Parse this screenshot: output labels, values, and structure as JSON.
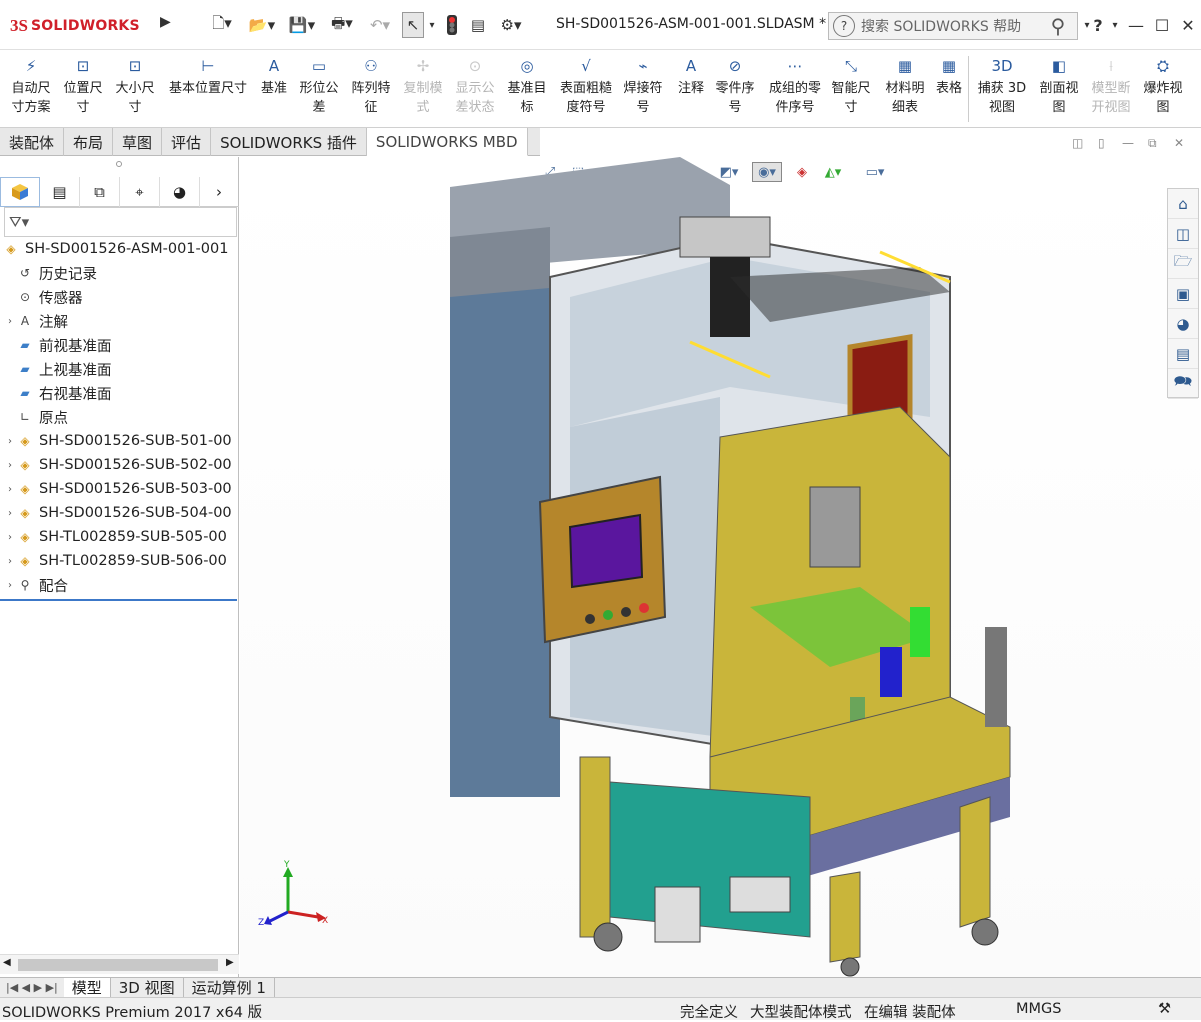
{
  "app": {
    "logo_ds": "3S",
    "logo_name": "SOLIDWORKS",
    "document_title": "SH-SD001526-ASM-001-001.SLDASM *",
    "search_placeholder": "搜索 SOLIDWORKS 帮助",
    "help_label": "?"
  },
  "ribbon": [
    {
      "label1": "自动尺",
      "label2": "寸方案",
      "icon": "auto-dimension-icon",
      "enabled": true
    },
    {
      "label1": "位置尺",
      "label2": "寸",
      "icon": "location-dimension-icon",
      "enabled": true
    },
    {
      "label1": "大小尺",
      "label2": "寸",
      "icon": "size-dimension-icon",
      "enabled": true
    },
    {
      "label1": "基本位置尺寸",
      "label2": "",
      "icon": "basic-location-dimension-icon",
      "enabled": true
    },
    {
      "label1": "基准",
      "label2": "",
      "icon": "datum-icon",
      "enabled": true
    },
    {
      "label1": "形位公",
      "label2": "差",
      "icon": "geometric-tolerance-icon",
      "enabled": true
    },
    {
      "label1": "阵列特",
      "label2": "征",
      "icon": "pattern-feature-icon",
      "enabled": true
    },
    {
      "label1": "复制模",
      "label2": "式",
      "icon": "copy-scheme-icon",
      "enabled": false
    },
    {
      "label1": "显示公",
      "label2": "差状态",
      "icon": "show-tolerance-status-icon",
      "enabled": false
    },
    {
      "label1": "基准目",
      "label2": "标",
      "icon": "datum-target-icon",
      "enabled": true
    },
    {
      "label1": "表面粗糙",
      "label2": "度符号",
      "icon": "surface-finish-icon",
      "enabled": true
    },
    {
      "label1": "焊接符",
      "label2": "号",
      "icon": "weld-symbol-icon",
      "enabled": true
    },
    {
      "label1": "注释",
      "label2": "",
      "icon": "note-icon",
      "enabled": true
    },
    {
      "label1": "零件序",
      "label2": "号",
      "icon": "balloon-icon",
      "enabled": true
    },
    {
      "label1": "成组的零",
      "label2": "件序号",
      "icon": "stacked-balloon-icon",
      "enabled": true
    },
    {
      "label1": "智能尺",
      "label2": "寸",
      "icon": "smart-dimension-icon",
      "enabled": true
    },
    {
      "label1": "材料明",
      "label2": "细表",
      "icon": "bom-icon",
      "enabled": true
    },
    {
      "label1": "表格",
      "label2": "",
      "icon": "table-icon",
      "enabled": true
    },
    {
      "label1": "捕获 3D",
      "label2": "视图",
      "icon": "capture-3d-view-icon",
      "enabled": true
    },
    {
      "label1": "剖面视",
      "label2": "图",
      "icon": "section-view-icon",
      "enabled": true
    },
    {
      "label1": "模型断",
      "label2": "开视图",
      "icon": "model-break-view-icon",
      "enabled": false
    },
    {
      "label1": "爆炸视",
      "label2": "图",
      "icon": "exploded-view-icon",
      "enabled": true
    }
  ],
  "tabs": [
    "装配体",
    "布局",
    "草图",
    "评估",
    "SOLIDWORKS 插件",
    "SOLIDWORKS MBD"
  ],
  "active_tab": "SOLIDWORKS MBD",
  "tree": {
    "root": "SH-SD001526-ASM-001-001",
    "items": [
      {
        "label": "历史记录",
        "icon": "history-icon",
        "expandable": false
      },
      {
        "label": "传感器",
        "icon": "sensor-icon",
        "expandable": false
      },
      {
        "label": "注解",
        "icon": "annotation-icon",
        "expandable": true
      },
      {
        "label": "前视基准面",
        "icon": "plane-icon",
        "expandable": false
      },
      {
        "label": "上视基准面",
        "icon": "plane-icon",
        "expandable": false
      },
      {
        "label": "右视基准面",
        "icon": "plane-icon",
        "expandable": false
      },
      {
        "label": "原点",
        "icon": "origin-icon",
        "expandable": false
      },
      {
        "label": "SH-SD001526-SUB-501-00",
        "icon": "subassembly-icon",
        "expandable": true
      },
      {
        "label": "SH-SD001526-SUB-502-00",
        "icon": "subassembly-icon",
        "expandable": true
      },
      {
        "label": "SH-SD001526-SUB-503-00",
        "icon": "subassembly-icon",
        "expandable": true
      },
      {
        "label": "SH-SD001526-SUB-504-00",
        "icon": "subassembly-icon",
        "expandable": true
      },
      {
        "label": "SH-TL002859-SUB-505-00",
        "icon": "subassembly-icon",
        "expandable": true
      },
      {
        "label": "SH-TL002859-SUB-506-00",
        "icon": "subassembly-icon",
        "expandable": true
      },
      {
        "label": "配合",
        "icon": "mates-icon",
        "expandable": true
      }
    ]
  },
  "bottom_tabs": [
    "模型",
    "3D 视图",
    "运动算例 1"
  ],
  "status": {
    "product": "SOLIDWORKS Premium 2017 x64 版",
    "definition": "完全定义",
    "mode": "大型装配体模式",
    "editing": "在编辑 装配体",
    "units": "MMGS"
  },
  "triad": {
    "x": "X",
    "y": "Y",
    "z": "Z"
  },
  "colors": {
    "brand_red": "#d0202a",
    "frame_yellow": "#c9b53a",
    "panel_orange": "#b5862b",
    "screen_purple": "#5a169e",
    "housing_gray": "#7f8894",
    "teal_panel": "#22a08f"
  }
}
